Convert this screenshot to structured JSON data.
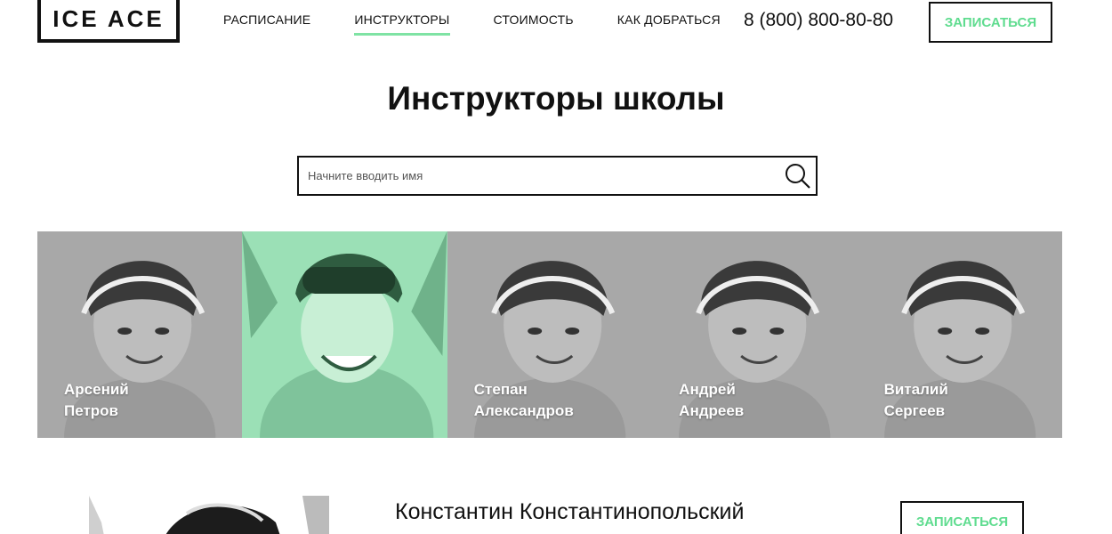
{
  "header": {
    "logo": "ICE ACE",
    "nav": [
      {
        "label": "Расписание",
        "active": false
      },
      {
        "label": "Инструкторы",
        "active": true
      },
      {
        "label": "Стоимость",
        "active": false
      },
      {
        "label": "Как добраться",
        "active": false
      }
    ],
    "phone": "8 (800) 800-80-80",
    "cta": "Записаться"
  },
  "page": {
    "title": "Инструкторы школы",
    "search_placeholder": "Начните вводить имя"
  },
  "instructors": [
    {
      "first": "Арсений",
      "last": "Петров",
      "selected": false
    },
    {
      "first": "",
      "last": "",
      "selected": true
    },
    {
      "first": "Степан",
      "last": "Александров",
      "selected": false
    },
    {
      "first": "Андрей",
      "last": "Андреев",
      "selected": false
    },
    {
      "first": "Виталий",
      "last": "Сергеев",
      "selected": false
    }
  ],
  "detail": {
    "name": "Константин Константинопольский",
    "cta": "Записаться"
  },
  "colors": {
    "accent": "#5fdc8f",
    "nav_underline": "#7fe3a4",
    "card_gray": "#a8a8a8",
    "card_selected": "#9be0b6",
    "ink": "#111111"
  }
}
